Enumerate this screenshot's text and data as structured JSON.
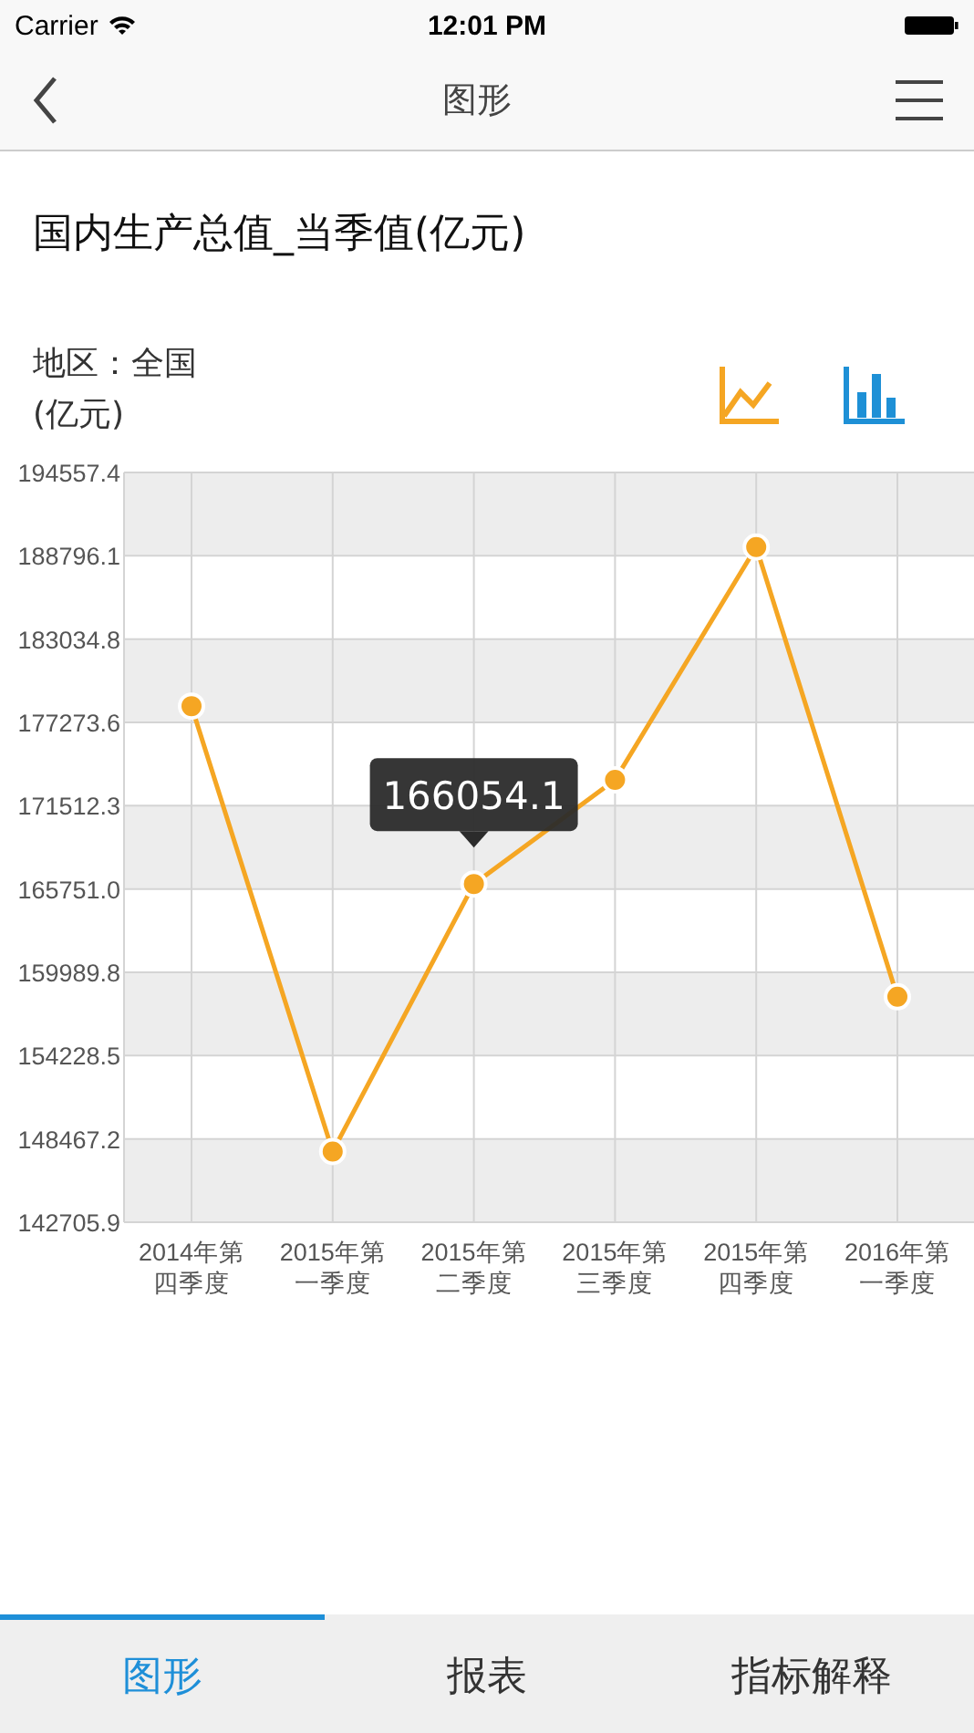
{
  "status_bar": {
    "carrier": "Carrier",
    "time": "12:01 PM"
  },
  "nav": {
    "title": "图形"
  },
  "heading": "国内生产总值_当季值(亿元)",
  "region": "地区：全国",
  "unit": "(亿元)",
  "chart_types": [
    {
      "kind": "line",
      "selected": true
    },
    {
      "kind": "bar",
      "selected": false
    }
  ],
  "chart_data": {
    "type": "line",
    "categories": [
      "2014年第四季度",
      "2015年第一季度",
      "2015年第二季度",
      "2015年第三季度",
      "2015年第四季度",
      "2016年第一季度"
    ],
    "grid": true,
    "series": [
      {
        "color": "#f5a623",
        "marker": "circle",
        "values": [
          178400,
          147600,
          166100,
          173300,
          189400,
          158300
        ]
      }
    ],
    "ylim": [
      142705.9,
      194557.4
    ],
    "yticks": [
      {
        "value": 142705.9,
        "label": "142705.9"
      },
      {
        "value": 148467.2,
        "label": "148467.2"
      },
      {
        "value": 154228.5,
        "label": "154228.5"
      },
      {
        "value": 159989.8,
        "label": "159989.8"
      },
      {
        "value": 165751.0,
        "label": "165751.0"
      },
      {
        "value": 171512.3,
        "label": "171512.3"
      },
      {
        "value": 177273.6,
        "label": "177273.6"
      },
      {
        "value": 183034.8,
        "label": "183034.8"
      },
      {
        "value": 188796.1,
        "label": "188796.1"
      },
      {
        "value": 194557.4,
        "label": "194557.4"
      }
    ],
    "annotations": [
      {
        "x": "2015年第二季度",
        "y": 166100,
        "text": "166054.1"
      }
    ]
  },
  "tabs": [
    {
      "label": "图形",
      "selected": true
    },
    {
      "label": "报表",
      "selected": false
    },
    {
      "label": "指标解释",
      "selected": false
    }
  ]
}
